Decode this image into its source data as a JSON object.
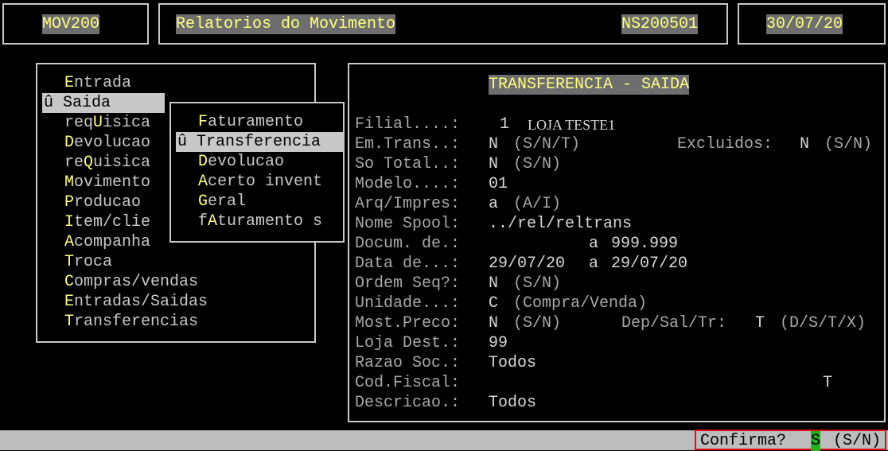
{
  "header": {
    "program": "MOV200",
    "title": "Relatorios do Movimento",
    "code": "NS200501",
    "date": "30/07/20"
  },
  "main_menu": {
    "items": [
      {
        "pre": "",
        "hot": "E",
        "post": "ntrada"
      },
      {
        "pre": "û Saida",
        "hot": "",
        "post": ""
      },
      {
        "pre": "req",
        "hot": "U",
        "post": "isica"
      },
      {
        "pre": "",
        "hot": "D",
        "post": "evolucao"
      },
      {
        "pre": "re",
        "hot": "Q",
        "post": "uisica"
      },
      {
        "pre": "",
        "hot": "M",
        "post": "ovimento"
      },
      {
        "pre": "",
        "hot": "P",
        "post": "roducao"
      },
      {
        "pre": "",
        "hot": "I",
        "post": "tem/clie"
      },
      {
        "pre": "",
        "hot": "A",
        "post": "companha"
      },
      {
        "pre": "",
        "hot": "T",
        "post": "roca"
      },
      {
        "pre": "",
        "hot": "C",
        "post": "ompras/vendas"
      },
      {
        "pre": "",
        "hot": "E",
        "post": "ntradas/Saidas"
      },
      {
        "pre": "",
        "hot": "T",
        "post": "ransferencias"
      }
    ]
  },
  "sub_menu": {
    "items": [
      {
        "pre": "",
        "hot": "F",
        "post": "aturamento"
      },
      {
        "pre": "û Transferencia",
        "hot": "",
        "post": ""
      },
      {
        "pre": "",
        "hot": "D",
        "post": "evolucao"
      },
      {
        "pre": "",
        "hot": "A",
        "post": "certo invent"
      },
      {
        "pre": "",
        "hot": "G",
        "post": "eral"
      },
      {
        "pre": "f",
        "hot": "A",
        "post": "turamento s"
      }
    ]
  },
  "form": {
    "title": "TRANSFERENCIA - SAIDA",
    "filial_label": "Filial....:",
    "filial_num": "1",
    "filial_name": "LOJA TESTE1",
    "emtrans_label": "Em.Trans..:",
    "emtrans_value": "N",
    "emtrans_hint": "(S/N/T)",
    "excluidos_label": "Excluidos:",
    "excluidos_value": "N",
    "excluidos_hint": "(S/N)",
    "sototal_label": "So Total..:",
    "sototal_value": "N",
    "sototal_hint": "(S/N)",
    "modelo_label": "Modelo....:",
    "modelo_value": "01",
    "arq_label": "Arq/Impres:",
    "arq_value": "a",
    "arq_hint": "(A/I)",
    "spool_label": "Nome Spool:",
    "spool_value": "../rel/reltrans",
    "docum_label": "Docum. de.:",
    "docum_sep": "a",
    "docum_to": "999.999",
    "data_label": "Data de...:",
    "data_from": "29/07/20",
    "data_sep": "a",
    "data_to": "29/07/20",
    "ordem_label": "Ordem Seq?:",
    "ordem_value": "N",
    "ordem_hint": "(S/N)",
    "unidade_label": "Unidade...:",
    "unidade_value": "C",
    "unidade_hint": "(Compra/Venda)",
    "preco_label": "Most.Preco:",
    "preco_value": "N",
    "preco_hint": "(S/N)",
    "dep_label": "Dep/Sal/Tr:",
    "dep_value": "T",
    "dep_hint": "(D/S/T/X)",
    "loja_label": "Loja Dest.:",
    "loja_value": "99",
    "razao_label": "Razao Soc.:",
    "razao_value": "Todos",
    "codfiscal_label": "Cod.Fiscal:",
    "codfiscal_value": "T",
    "descricao_label": "Descricao.:",
    "descricao_value": "Todos"
  },
  "status": {
    "confirm_label": "Confirma?",
    "confirm_value": "S",
    "confirm_hint": "(S/N)"
  }
}
